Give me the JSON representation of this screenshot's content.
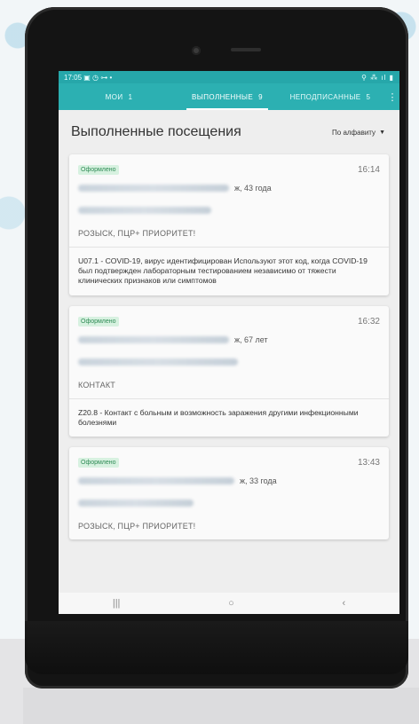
{
  "status_bar": {
    "time_icons": "17:05 ▣ ◷ ⊶ •",
    "right_icons": "⚲ ⁂ ıl ▮"
  },
  "tabs": [
    {
      "label": "мои",
      "count": "1"
    },
    {
      "label": "выполненные",
      "count": "9"
    },
    {
      "label": "неподписанные",
      "count": "5"
    }
  ],
  "menu_icon": "kebab-menu-icon",
  "page": {
    "title": "Выполненные посещения",
    "sort_label": "По алфавиту"
  },
  "cards": [
    {
      "status": "Оформлено",
      "time": "16:14",
      "demographics": "ж, 43 года",
      "reason": "РОЗЫСК, ПЦР+ ПРИОРИТЕТ!",
      "diagnosis": "U07.1 - COVID-19, вирус идентифицирован Используют этот код, когда COVID-19 был подтвержден лабораторным тестированием независимо от тяжести клинических признаков или симптомов"
    },
    {
      "status": "Оформлено",
      "time": "16:32",
      "demographics": "ж, 67 лет",
      "reason": "контакт",
      "diagnosis": "Z20.8 - Контакт с больным и возможность заражения другими инфекционными болезнями"
    },
    {
      "status": "Оформлено",
      "time": "13:43",
      "demographics": "ж, 33 года",
      "reason": "РОЗЫСК, ПЦР+ ПРИОРИТЕТ!",
      "diagnosis": ""
    }
  ],
  "nav": {
    "recents": "|||",
    "home": "○",
    "back": "‹"
  }
}
